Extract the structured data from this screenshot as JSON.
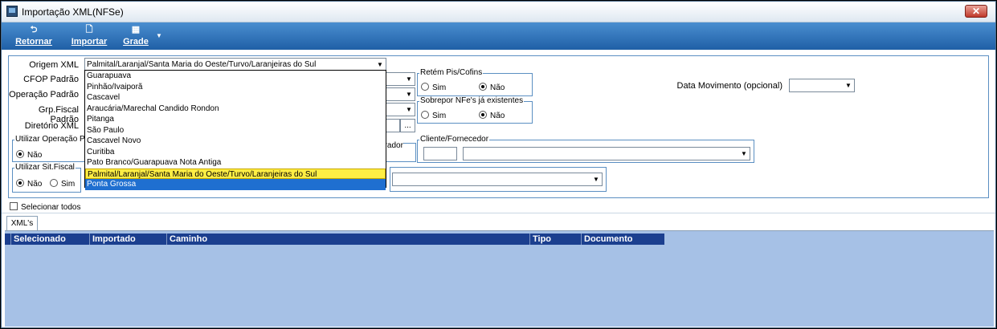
{
  "window": {
    "title": "Importação XML(NFSe)",
    "close_glyph": "✕"
  },
  "toolbar": {
    "retornar": {
      "label": "Retornar",
      "icon": "undo-arrow-icon",
      "glyph": "⮌"
    },
    "importar": {
      "label": "Importar",
      "icon": "document-icon",
      "glyph": "🗋"
    },
    "grade": {
      "label": "Grade",
      "icon": "grid-icon",
      "glyph": "▦",
      "dropdown_glyph": "▼"
    }
  },
  "form": {
    "origem_label": "Origem XML",
    "origem_value": "Palmital/Laranjal/Santa Maria do Oeste/Turvo/Laranjeiras do Sul",
    "cfop_label": "CFOP Padrão",
    "operacao_label": "Operação Padrão",
    "grp_fiscal_label": "Grp.Fiscal Padrão",
    "diretorio_label": "Diretório XML",
    "diretorio_button": "...",
    "utilizar_operacao_title": "Utilizar Operação P",
    "utilizar_operacao_nao": "Não",
    "utilizar_sit_title": "Utilizar Sit.Fiscal",
    "utilizar_sit_nao": "Não",
    "utilizar_sit_sim": "Sim",
    "retem_title": "Retém Pis/Cofins",
    "retem_sim": "Sim",
    "retem_nao": "Não",
    "sobrepor_title": "Sobrepor NFe's já existentes",
    "sobrepor_sim": "Sim",
    "sobrepor_nao": "Não",
    "data_movimento_label": "Data Movimento (opcional)",
    "gerador_fragment": "erador",
    "cliente_title": "Cliente/Fornecedor",
    "arrow_glyph": "▼"
  },
  "dropdown_options": [
    "Guarapuava",
    "Pinhão/Ivaiporã",
    "Cascavel",
    "Araucária/Marechal Candido Rondon",
    "Pitanga",
    "São Paulo",
    "Cascavel Novo",
    "Curitiba",
    "Pato Branco/Guarapuava Nota Antiga",
    "Palmital/Laranjal/Santa Maria do Oeste/Turvo/Laranjeiras do Sul",
    "Ponta Grossa"
  ],
  "selecionar_todos": "Selecionar todos",
  "tab_label": "XML's",
  "grid": {
    "columns": [
      "Selecionado",
      "Importado",
      "Caminho",
      "Tipo",
      "Documento"
    ]
  }
}
